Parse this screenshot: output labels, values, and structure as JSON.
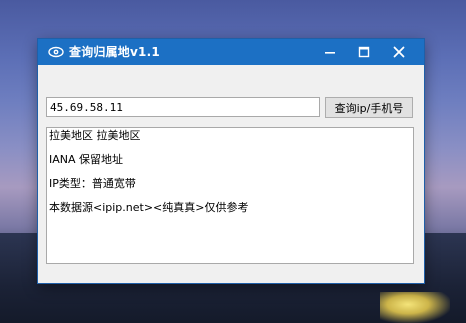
{
  "window": {
    "title": "查询归属地v1.1",
    "controls": {
      "minimize_icon": "minimize-icon",
      "maximize_icon": "maximize-icon",
      "close_icon": "close-icon"
    }
  },
  "query": {
    "ip_value": "45.69.58.11",
    "button_label": "查询ip/手机号"
  },
  "results": {
    "lines": [
      "拉美地区 拉美地区",
      "IANA 保留地址",
      "IP类型：普通宽带",
      "本数据源<ipip.net><纯真真>仅供参考"
    ]
  },
  "colors": {
    "titlebar": "#1c70c4",
    "window_bg": "#f0f0f0"
  }
}
